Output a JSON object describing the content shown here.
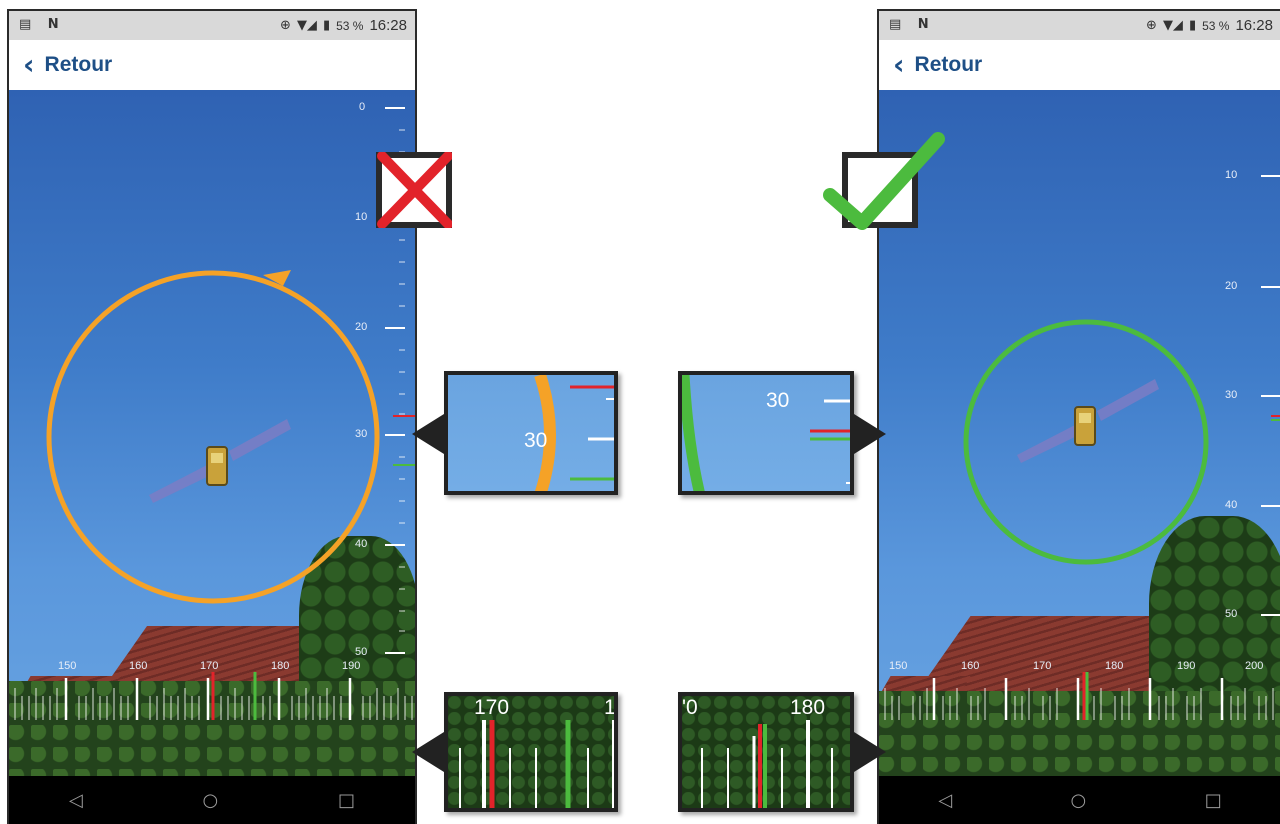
{
  "left_phone": {
    "status": {
      "left_icons": "▤ N",
      "battery_pct": "53 %",
      "time": "16:28"
    },
    "back_label": "Retour",
    "vertical_scale": [
      "0",
      "10",
      "20",
      "30",
      "40",
      "50"
    ],
    "horizontal_scale": [
      "150",
      "160",
      "170",
      "180",
      "190"
    ],
    "target_circle_color": "#f5a227",
    "result_mark": "cross",
    "result_color": "#e2232a"
  },
  "right_phone": {
    "status": {
      "left_icons": "▤ N",
      "battery_pct": "53 %",
      "time": "16:28"
    },
    "back_label": "Retour",
    "vertical_scale": [
      "10",
      "20",
      "30",
      "40",
      "50"
    ],
    "horizontal_scale": [
      "150",
      "160",
      "170",
      "180",
      "190",
      "200"
    ],
    "target_circle_color": "#4cbb3e",
    "result_mark": "check",
    "result_color": "#4cbb3e"
  },
  "zoom_left_elevation": {
    "label": "30"
  },
  "zoom_right_elevation": {
    "label": "30"
  },
  "zoom_left_azimuth": {
    "labels": [
      "170",
      "1"
    ]
  },
  "zoom_right_azimuth": {
    "labels": [
      "'0",
      "180"
    ]
  },
  "nav_icons": {
    "back": "◁",
    "home": "○",
    "recent": "□"
  },
  "colors": {
    "elevation_marker": "#e2232a",
    "satellite_marker": "#4cbb3e",
    "aligned_ring": "#4cbb3e",
    "misaligned_ring": "#f5a227"
  }
}
